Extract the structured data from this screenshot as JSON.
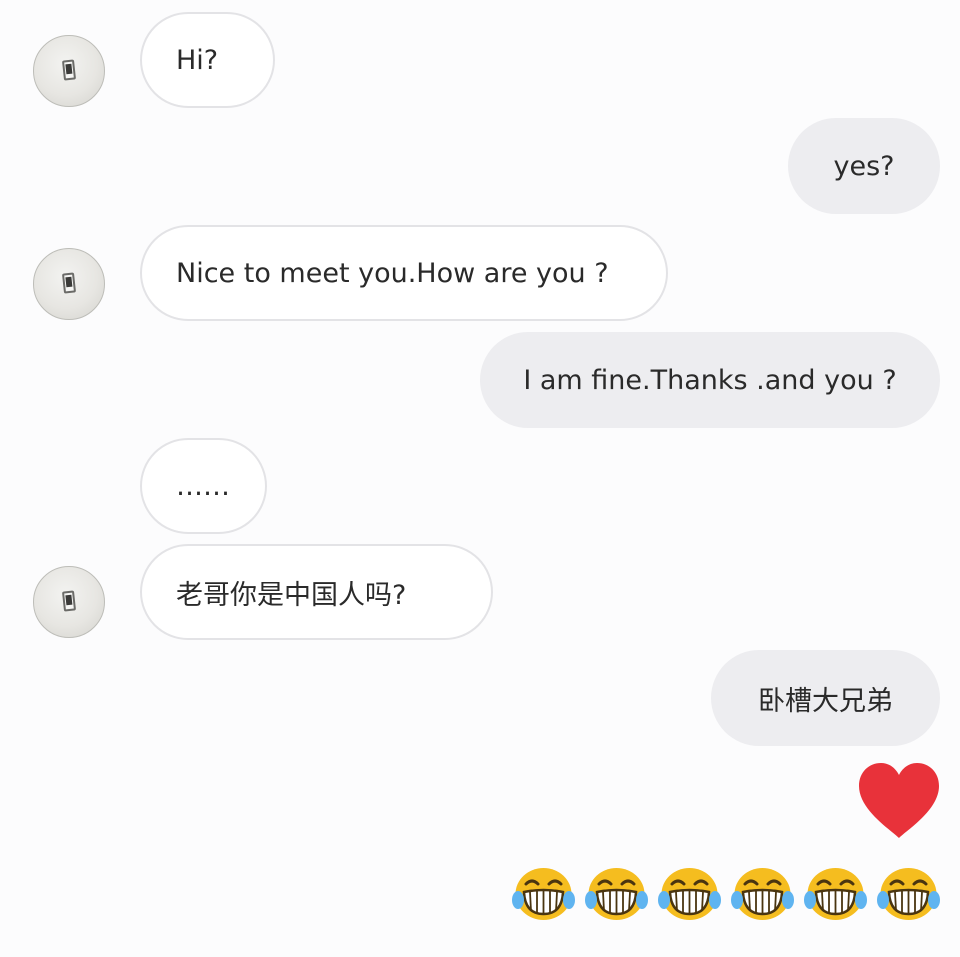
{
  "conversation": {
    "messages": [
      {
        "sender": "them",
        "text": "Hi?"
      },
      {
        "sender": "me",
        "text": "yes?"
      },
      {
        "sender": "them",
        "text": "Nice to meet you.How are you ?"
      },
      {
        "sender": "me",
        "text": "I am fine.Thanks .and you ?"
      },
      {
        "sender": "them",
        "text": "……"
      },
      {
        "sender": "them",
        "text": "老哥你是中国人吗?"
      },
      {
        "sender": "me",
        "text": "卧槽大兄弟"
      }
    ],
    "reactions": {
      "heart": "heart-icon",
      "laugh_count": 6,
      "laugh": "laughing-tears-emoji"
    }
  },
  "colors": {
    "background": "#fcfcfd",
    "incoming_bubble": "#ffffff",
    "incoming_border": "#e3e3e6",
    "outgoing_bubble": "#ededf0",
    "text": "#2a2a2a",
    "heart": "#e8323a",
    "emoji": "#f5bd1f"
  }
}
